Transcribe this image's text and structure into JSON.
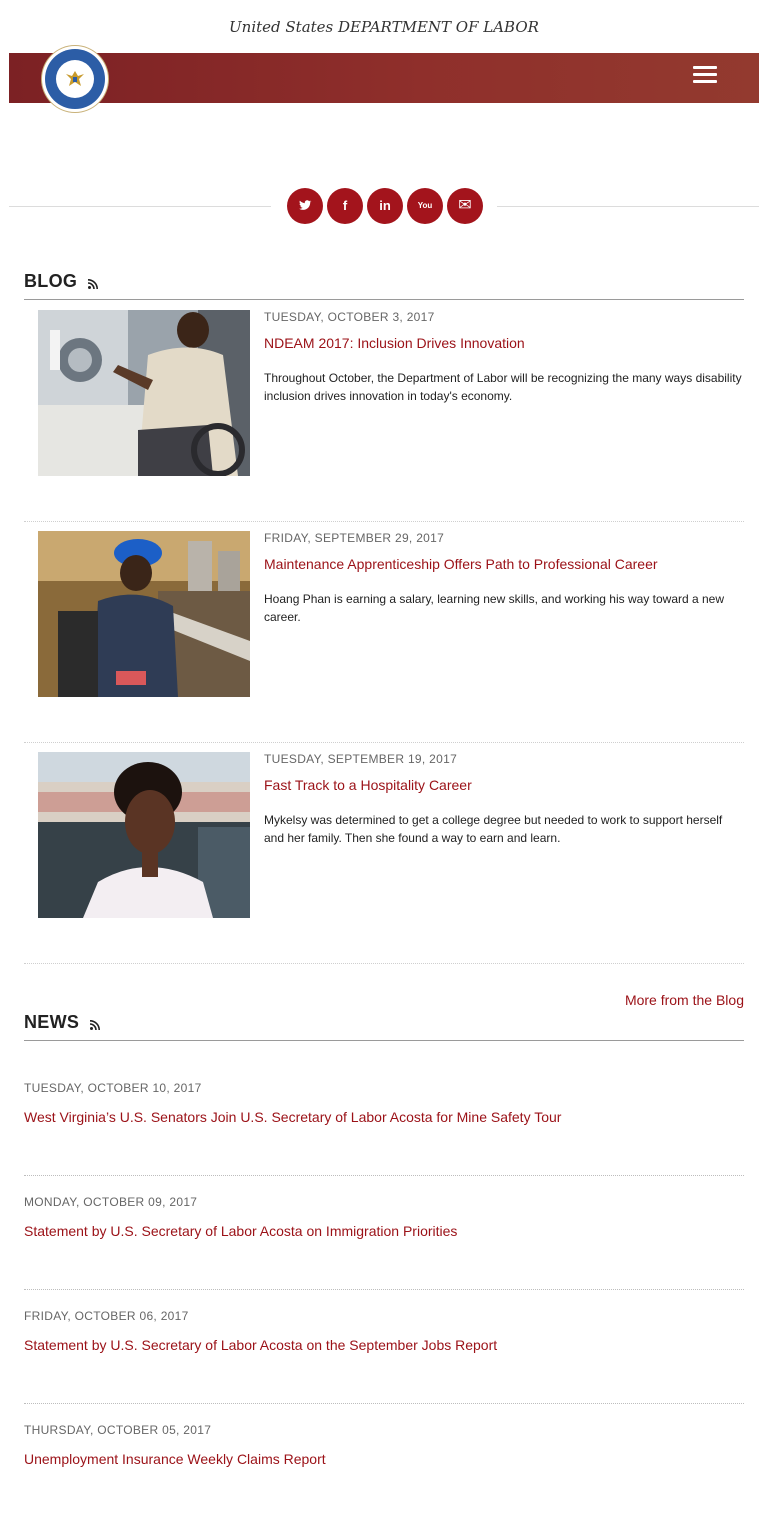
{
  "header": {
    "site_title": "United States DEPARTMENT OF LABOR",
    "seal": "department-of-labor-seal",
    "menu_icon": "hamburger-menu-icon"
  },
  "social": [
    {
      "name": "twitter",
      "glyph": "t"
    },
    {
      "name": "facebook",
      "glyph": "f"
    },
    {
      "name": "linkedin",
      "glyph": "in"
    },
    {
      "name": "youtube",
      "glyph": "You"
    },
    {
      "name": "email",
      "glyph": "✉"
    }
  ],
  "blog": {
    "heading": "BLOG",
    "posts": [
      {
        "date": "TUESDAY, OCTOBER 3, 2017",
        "title": "NDEAM 2017: Inclusion Drives Innovation",
        "blurb": "Throughout October, the Department of Labor will be recognizing the many ways disability inclusion drives innovation in today's economy."
      },
      {
        "date": "FRIDAY, SEPTEMBER 29, 2017",
        "title": "Maintenance Apprenticeship Offers Path to Professional Career",
        "blurb": "Hoang Phan is earning a salary, learning new skills, and working his way toward a new career."
      },
      {
        "date": "TUESDAY, SEPTEMBER 19, 2017",
        "title": "Fast Track to a Hospitality Career",
        "blurb": "Mykelsy was determined to get a college degree but needed to work to support herself and her family. Then she found a way to earn and learn."
      }
    ],
    "more_link": "More from the Blog"
  },
  "news": {
    "heading": "NEWS",
    "items": [
      {
        "date": "TUESDAY, OCTOBER 10, 2017",
        "title": "West Virginia’s U.S. Senators Join U.S. Secretary of Labor Acosta for Mine Safety Tour"
      },
      {
        "date": "MONDAY, OCTOBER 09, 2017",
        "title": "Statement by U.S. Secretary of Labor Acosta on Immigration Priorities"
      },
      {
        "date": "FRIDAY, OCTOBER 06, 2017",
        "title": "Statement by U.S. Secretary of Labor Acosta on the September Jobs Report"
      },
      {
        "date": "THURSDAY, OCTOBER 05, 2017",
        "title": "Unemployment Insurance Weekly Claims Report"
      }
    ]
  },
  "colors": {
    "brand_red": "#9b1117",
    "header_bar": "#8a2a28",
    "social_red": "#a3141c"
  }
}
